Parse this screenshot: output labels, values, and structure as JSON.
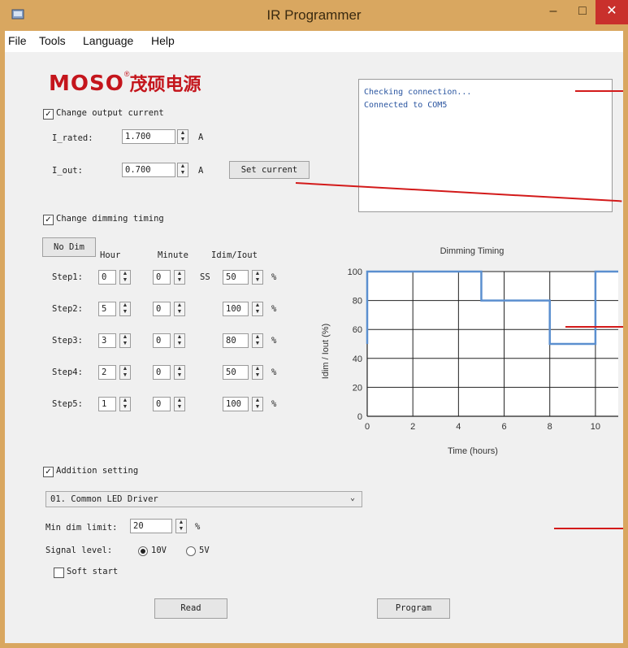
{
  "window": {
    "title": "IR Programmer",
    "min": "–",
    "max": "□",
    "close": "✕"
  },
  "menu": [
    "File",
    "Tools",
    "Language",
    "Help"
  ],
  "logo": {
    "en": "MOSO",
    "cn": "茂硕电源",
    "reg": "®"
  },
  "output": {
    "checkbox_label": "Change output current",
    "checked": true,
    "i_rated_label": "I_rated:",
    "i_rated_value": "1.700",
    "i_out_label": "I_out:",
    "i_out_value": "0.700",
    "unit": "A",
    "set_current_label": "Set current"
  },
  "log": [
    "Checking connection...",
    "Connected to COM5"
  ],
  "dimming": {
    "checkbox_label": "Change dimming timing",
    "checked": true,
    "no_dim_label": "No Dim",
    "col_hour": "Hour",
    "col_minute": "Minute",
    "col_ratio": "Idim/Iout",
    "ss_label": "SS",
    "percent": "%",
    "steps": [
      {
        "label": "Step1:",
        "hour": "0",
        "minute": "0",
        "ratio": "50"
      },
      {
        "label": "Step2:",
        "hour": "5",
        "minute": "0",
        "ratio": "100"
      },
      {
        "label": "Step3:",
        "hour": "3",
        "minute": "0",
        "ratio": "80"
      },
      {
        "label": "Step4:",
        "hour": "2",
        "minute": "0",
        "ratio": "50"
      },
      {
        "label": "Step5:",
        "hour": "1",
        "minute": "0",
        "ratio": "100"
      }
    ]
  },
  "chart_data": {
    "type": "line",
    "title": "Dimming Timing",
    "xlabel": "Time (hours)",
    "ylabel": "Idim / Iout (%)",
    "xlim": [
      0,
      11
    ],
    "ylim": [
      0,
      100
    ],
    "x_ticks": [
      0,
      2,
      4,
      6,
      8,
      10
    ],
    "y_ticks": [
      0,
      20,
      40,
      60,
      80,
      100
    ],
    "grid": true,
    "line_color": "#5b8fcf",
    "series": [
      {
        "x": [
          0,
          0,
          5,
          5,
          8,
          8,
          10,
          10,
          11
        ],
        "y": [
          50,
          100,
          100,
          80,
          80,
          50,
          50,
          100,
          100
        ]
      }
    ]
  },
  "addition": {
    "checkbox_label": "Addition setting",
    "checked": true,
    "driver": "01. Common LED Driver",
    "min_dim_label": "Min dim limit:",
    "min_dim_value": "20",
    "percent": "%",
    "signal_label": "Signal level:",
    "opt_10v": "10V",
    "opt_5v": "5V",
    "selected_signal": "10V",
    "soft_start_label": "Soft start",
    "soft_start_checked": false
  },
  "buttons": {
    "read": "Read",
    "program": "Program"
  },
  "colors": {
    "title_bar": "#d9a760",
    "close": "#c9302c",
    "brand": "#c4151c",
    "callout": "#d31a1a",
    "chart_line": "#5b8fcf"
  }
}
